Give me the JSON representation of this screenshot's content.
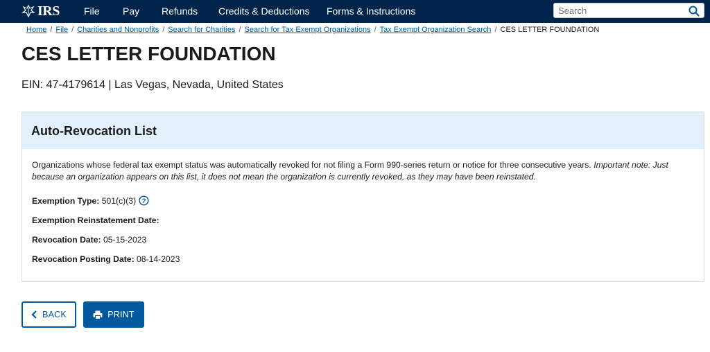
{
  "header": {
    "logo_text": "IRS",
    "nav": [
      "File",
      "Pay",
      "Refunds",
      "Credits & Deductions",
      "Forms & Instructions"
    ],
    "search_placeholder": "Search"
  },
  "breadcrumb": {
    "links": [
      "Home",
      "File",
      "Charities and Nonprofits",
      "Search for Charities",
      "Search for Tax Exempt Organizations",
      "Tax Exempt Organization Search"
    ],
    "current": "CES LETTER FOUNDATION"
  },
  "org": {
    "name": "CES LETTER FOUNDATION",
    "ein_line": "EIN: 47-4179614 | Las Vegas, Nevada, United States"
  },
  "panel": {
    "title": "Auto-Revocation List",
    "description": "Organizations whose federal tax exempt status was automatically revoked for not filing a Form 990-series return or notice for three consecutive years.",
    "note": "Important note: Just because an organization appears on this list, it does not mean the organization is currently revoked, as they may have been reinstated.",
    "fields": [
      {
        "label": "Exemption Type:",
        "value": "501(c)(3)"
      },
      {
        "label": "Exemption Reinstatement Date:",
        "value": ""
      },
      {
        "label": "Revocation Date:",
        "value": "05-15-2023"
      },
      {
        "label": "Revocation Posting Date:",
        "value": "08-14-2023"
      }
    ]
  },
  "buttons": {
    "back_label": "BACK",
    "print_label": "PRINT"
  },
  "colors": {
    "header_bg": "#00244a",
    "panel_header_bg": "#e1f0fb",
    "primary": "#00599c"
  }
}
